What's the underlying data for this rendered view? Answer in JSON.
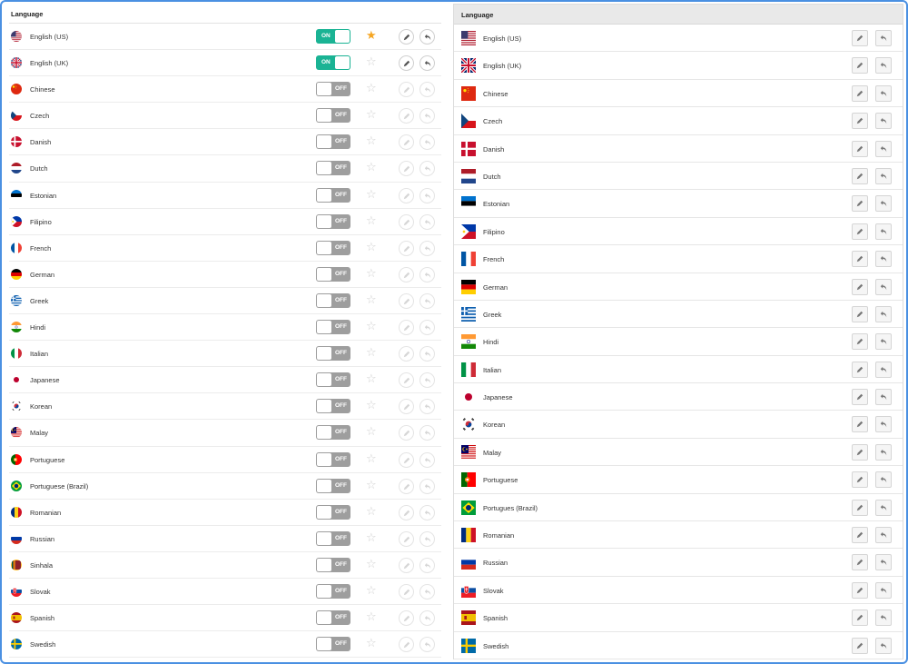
{
  "left_panel": {
    "header": "Language",
    "rows": [
      {
        "label": "English (US)",
        "toggle": "ON",
        "state": "on",
        "starred": true,
        "flag": "us"
      },
      {
        "label": "English (UK)",
        "toggle": "ON",
        "state": "on",
        "starred": false,
        "flag": "uk"
      },
      {
        "label": "Chinese",
        "toggle": "OFF",
        "state": "off",
        "starred": false,
        "flag": "cn"
      },
      {
        "label": "Czech",
        "toggle": "OFF",
        "state": "off",
        "starred": false,
        "flag": "cz"
      },
      {
        "label": "Danish",
        "toggle": "OFF",
        "state": "off",
        "starred": false,
        "flag": "dk"
      },
      {
        "label": "Dutch",
        "toggle": "OFF",
        "state": "off",
        "starred": false,
        "flag": "nl"
      },
      {
        "label": "Estonian",
        "toggle": "OFF",
        "state": "off",
        "starred": false,
        "flag": "ee"
      },
      {
        "label": "Filipino",
        "toggle": "OFF",
        "state": "off",
        "starred": false,
        "flag": "ph"
      },
      {
        "label": "French",
        "toggle": "OFF",
        "state": "off",
        "starred": false,
        "flag": "fr"
      },
      {
        "label": "German",
        "toggle": "OFF",
        "state": "off",
        "starred": false,
        "flag": "de"
      },
      {
        "label": "Greek",
        "toggle": "OFF",
        "state": "off",
        "starred": false,
        "flag": "gr"
      },
      {
        "label": "Hindi",
        "toggle": "OFF",
        "state": "off",
        "starred": false,
        "flag": "in"
      },
      {
        "label": "Italian",
        "toggle": "OFF",
        "state": "off",
        "starred": false,
        "flag": "it"
      },
      {
        "label": "Japanese",
        "toggle": "OFF",
        "state": "off",
        "starred": false,
        "flag": "jp"
      },
      {
        "label": "Korean",
        "toggle": "OFF",
        "state": "off",
        "starred": false,
        "flag": "kr"
      },
      {
        "label": "Malay",
        "toggle": "OFF",
        "state": "off",
        "starred": false,
        "flag": "my"
      },
      {
        "label": "Portuguese",
        "toggle": "OFF",
        "state": "off",
        "starred": false,
        "flag": "pt"
      },
      {
        "label": "Portuguese (Brazil)",
        "toggle": "OFF",
        "state": "off",
        "starred": false,
        "flag": "br"
      },
      {
        "label": "Romanian",
        "toggle": "OFF",
        "state": "off",
        "starred": false,
        "flag": "ro"
      },
      {
        "label": "Russian",
        "toggle": "OFF",
        "state": "off",
        "starred": false,
        "flag": "ru"
      },
      {
        "label": "Sinhala",
        "toggle": "OFF",
        "state": "off",
        "starred": false,
        "flag": "lk"
      },
      {
        "label": "Slovak",
        "toggle": "OFF",
        "state": "off",
        "starred": false,
        "flag": "sk"
      },
      {
        "label": "Spanish",
        "toggle": "OFF",
        "state": "off",
        "starred": false,
        "flag": "es"
      },
      {
        "label": "Swedish",
        "toggle": "OFF",
        "state": "off",
        "starred": false,
        "flag": "se"
      }
    ]
  },
  "right_panel": {
    "header": "Language",
    "rows": [
      {
        "label": "English (US)",
        "flag": "us"
      },
      {
        "label": "English (UK)",
        "flag": "uk"
      },
      {
        "label": "Chinese",
        "flag": "cn"
      },
      {
        "label": "Czech",
        "flag": "cz"
      },
      {
        "label": "Danish",
        "flag": "dk"
      },
      {
        "label": "Dutch",
        "flag": "nl"
      },
      {
        "label": "Estonian",
        "flag": "ee"
      },
      {
        "label": "Filipino",
        "flag": "ph"
      },
      {
        "label": "French",
        "flag": "fr"
      },
      {
        "label": "German",
        "flag": "de"
      },
      {
        "label": "Greek",
        "flag": "gr"
      },
      {
        "label": "Hindi",
        "flag": "in"
      },
      {
        "label": "Italian",
        "flag": "it"
      },
      {
        "label": "Japanese",
        "flag": "jp"
      },
      {
        "label": "Korean",
        "flag": "kr"
      },
      {
        "label": "Malay",
        "flag": "my"
      },
      {
        "label": "Portuguese",
        "flag": "pt"
      },
      {
        "label": "Portugues (Brazil)",
        "flag": "br"
      },
      {
        "label": "Romanian",
        "flag": "ro"
      },
      {
        "label": "Russian",
        "flag": "ru"
      },
      {
        "label": "Slovak",
        "flag": "sk"
      },
      {
        "label": "Spanish",
        "flag": "es"
      },
      {
        "label": "Swedish",
        "flag": "se"
      }
    ]
  },
  "icons": {
    "edit": "pencil-icon",
    "undo": "undo-arrow-icon",
    "star": "star-icon"
  },
  "colors": {
    "toggle_on": "#1ab394",
    "toggle_off": "#9e9e9e",
    "star_filled": "#f5a623",
    "star_empty": "#d0d0d0",
    "frame_border": "#4a90e2"
  }
}
